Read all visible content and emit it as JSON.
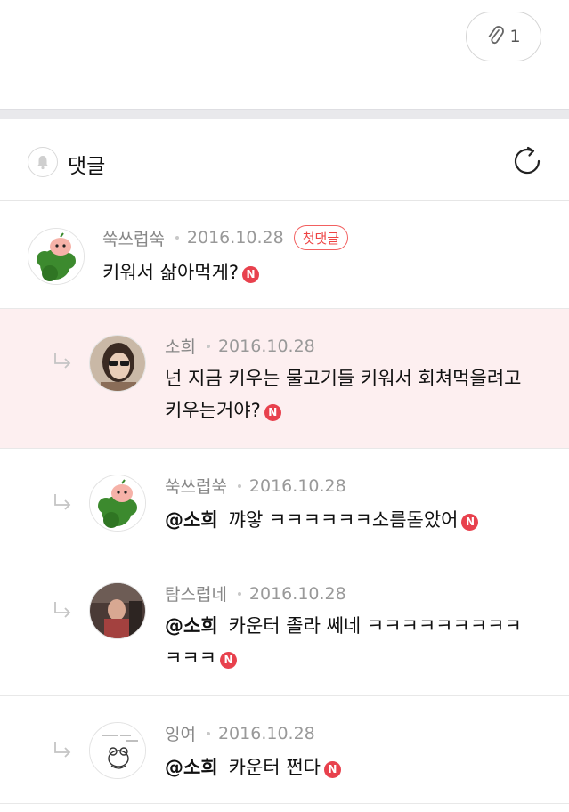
{
  "attachment": {
    "icon": "paperclip-icon",
    "count": "1"
  },
  "comments_header": {
    "bell_icon": "bell-icon",
    "title": "댓글",
    "refresh_icon": "refresh-icon"
  },
  "new_badge": "N",
  "comments": [
    {
      "author": "쑥쓰럽쑥",
      "date": "2016.10.28",
      "badge": "첫댓글",
      "text": "키워서 삶아먹게?"
    },
    {
      "author": "소희",
      "date": "2016.10.28",
      "text_line1": "넌 지금 키우는 물고기들 키워서 회쳐먹을려고",
      "text_line2": "키우는거야?"
    },
    {
      "author": "쑥쓰럽쑥",
      "date": "2016.10.28",
      "mention": "@소희",
      "text": "꺄앟 ㅋㅋㅋㅋㅋㅋ소름돋았어"
    },
    {
      "author": "탐스럽네",
      "date": "2016.10.28",
      "mention": "@소희",
      "text_line1": "카운터 졸라 쎄네 ㅋㅋㅋㅋㅋㅋㅋㅋㅋ",
      "text_line2": "ㅋㅋㅋ"
    },
    {
      "author": "잉여",
      "date": "2016.10.28",
      "mention": "@소희",
      "text": "카운터 쩐다"
    }
  ],
  "colors": {
    "accent_red": "#e8414d",
    "highlight_bg": "#fdeff0",
    "divider": "#e9e9ec"
  }
}
